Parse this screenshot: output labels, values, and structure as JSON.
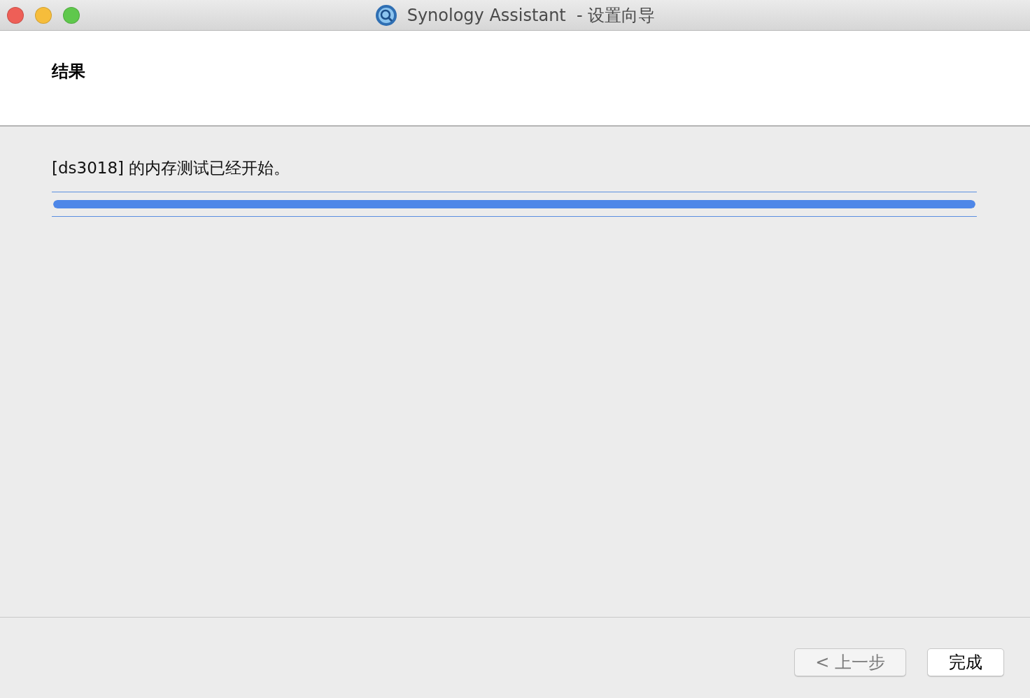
{
  "window": {
    "title": "Synology Assistant  - 设置向导"
  },
  "header": {
    "title": "结果"
  },
  "message": "[ds3018] 的内存测试已经开始。",
  "progress": {
    "level": 1
  },
  "buttons": [
    {
      "label": "< 上一步",
      "disabled": true
    },
    {
      "label": "完成",
      "disabled": false
    }
  ]
}
